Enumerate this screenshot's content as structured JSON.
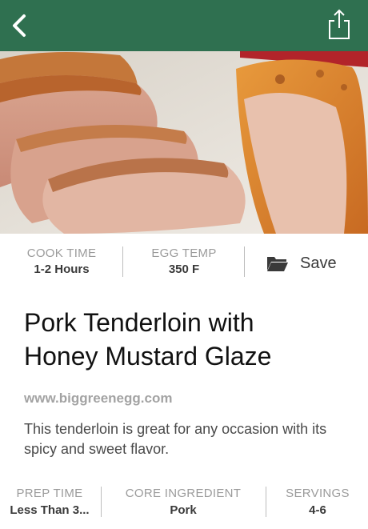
{
  "nav": {
    "back_icon": "chevron-left-icon",
    "share_icon": "share-icon",
    "bar_color": "#2f7050"
  },
  "hero": {
    "image": "sliced pork tenderloin with glaze"
  },
  "stats": {
    "cook_time_label": "COOK TIME",
    "cook_time_value": "1-2 Hours",
    "egg_temp_label": "EGG TEMP",
    "egg_temp_value": "350 F",
    "save_label": "Save",
    "save_icon": "folder-icon"
  },
  "recipe": {
    "title_line1": "Pork Tenderloin with",
    "title_line2": "Honey Mustard Glaze",
    "source": "www.biggreenegg.com",
    "description": "This tenderloin is great for any occasion with its spicy and sweet flavor."
  },
  "details": {
    "prep_time_label": "PREP TIME",
    "prep_time_value": "Less Than 3...",
    "core_ingredient_label": "CORE INGREDIENT",
    "core_ingredient_value": "Pork",
    "servings_label": "SERVINGS",
    "servings_value": "4-6"
  }
}
